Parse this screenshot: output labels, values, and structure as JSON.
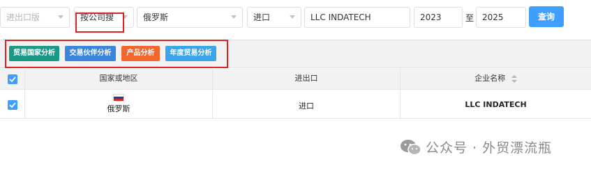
{
  "filters": {
    "direction_select": {
      "value": "进出口版"
    },
    "search_mode_select": {
      "value": "按公司搜"
    },
    "country_select": {
      "value": "俄罗斯"
    },
    "trade_type_select": {
      "value": "进口"
    },
    "company_input": {
      "value": "LLC INDATECH"
    },
    "year_from": {
      "value": "2023"
    },
    "year_separator": "至",
    "year_to": {
      "value": "2025"
    },
    "query_button": "查询"
  },
  "analysis_buttons": [
    {
      "label": "贸易国家分析",
      "color": "#1a9a86"
    },
    {
      "label": "交易伙伴分析",
      "color": "#3a86dd"
    },
    {
      "label": "产品分析",
      "color": "#f4662e"
    },
    {
      "label": "年度贸易分析",
      "color": "#3aa5e8"
    }
  ],
  "table": {
    "headers": [
      "国家或地区",
      "进出口",
      "企业名称"
    ],
    "rows": [
      {
        "country": "俄罗斯",
        "trade": "进口",
        "company": "LLC INDATECH",
        "flag": "russia-flag"
      }
    ]
  },
  "watermark": "公众号 · 外贸漂流瓶",
  "colors": {
    "accent": "#409eff",
    "highlight": "#e02020"
  }
}
